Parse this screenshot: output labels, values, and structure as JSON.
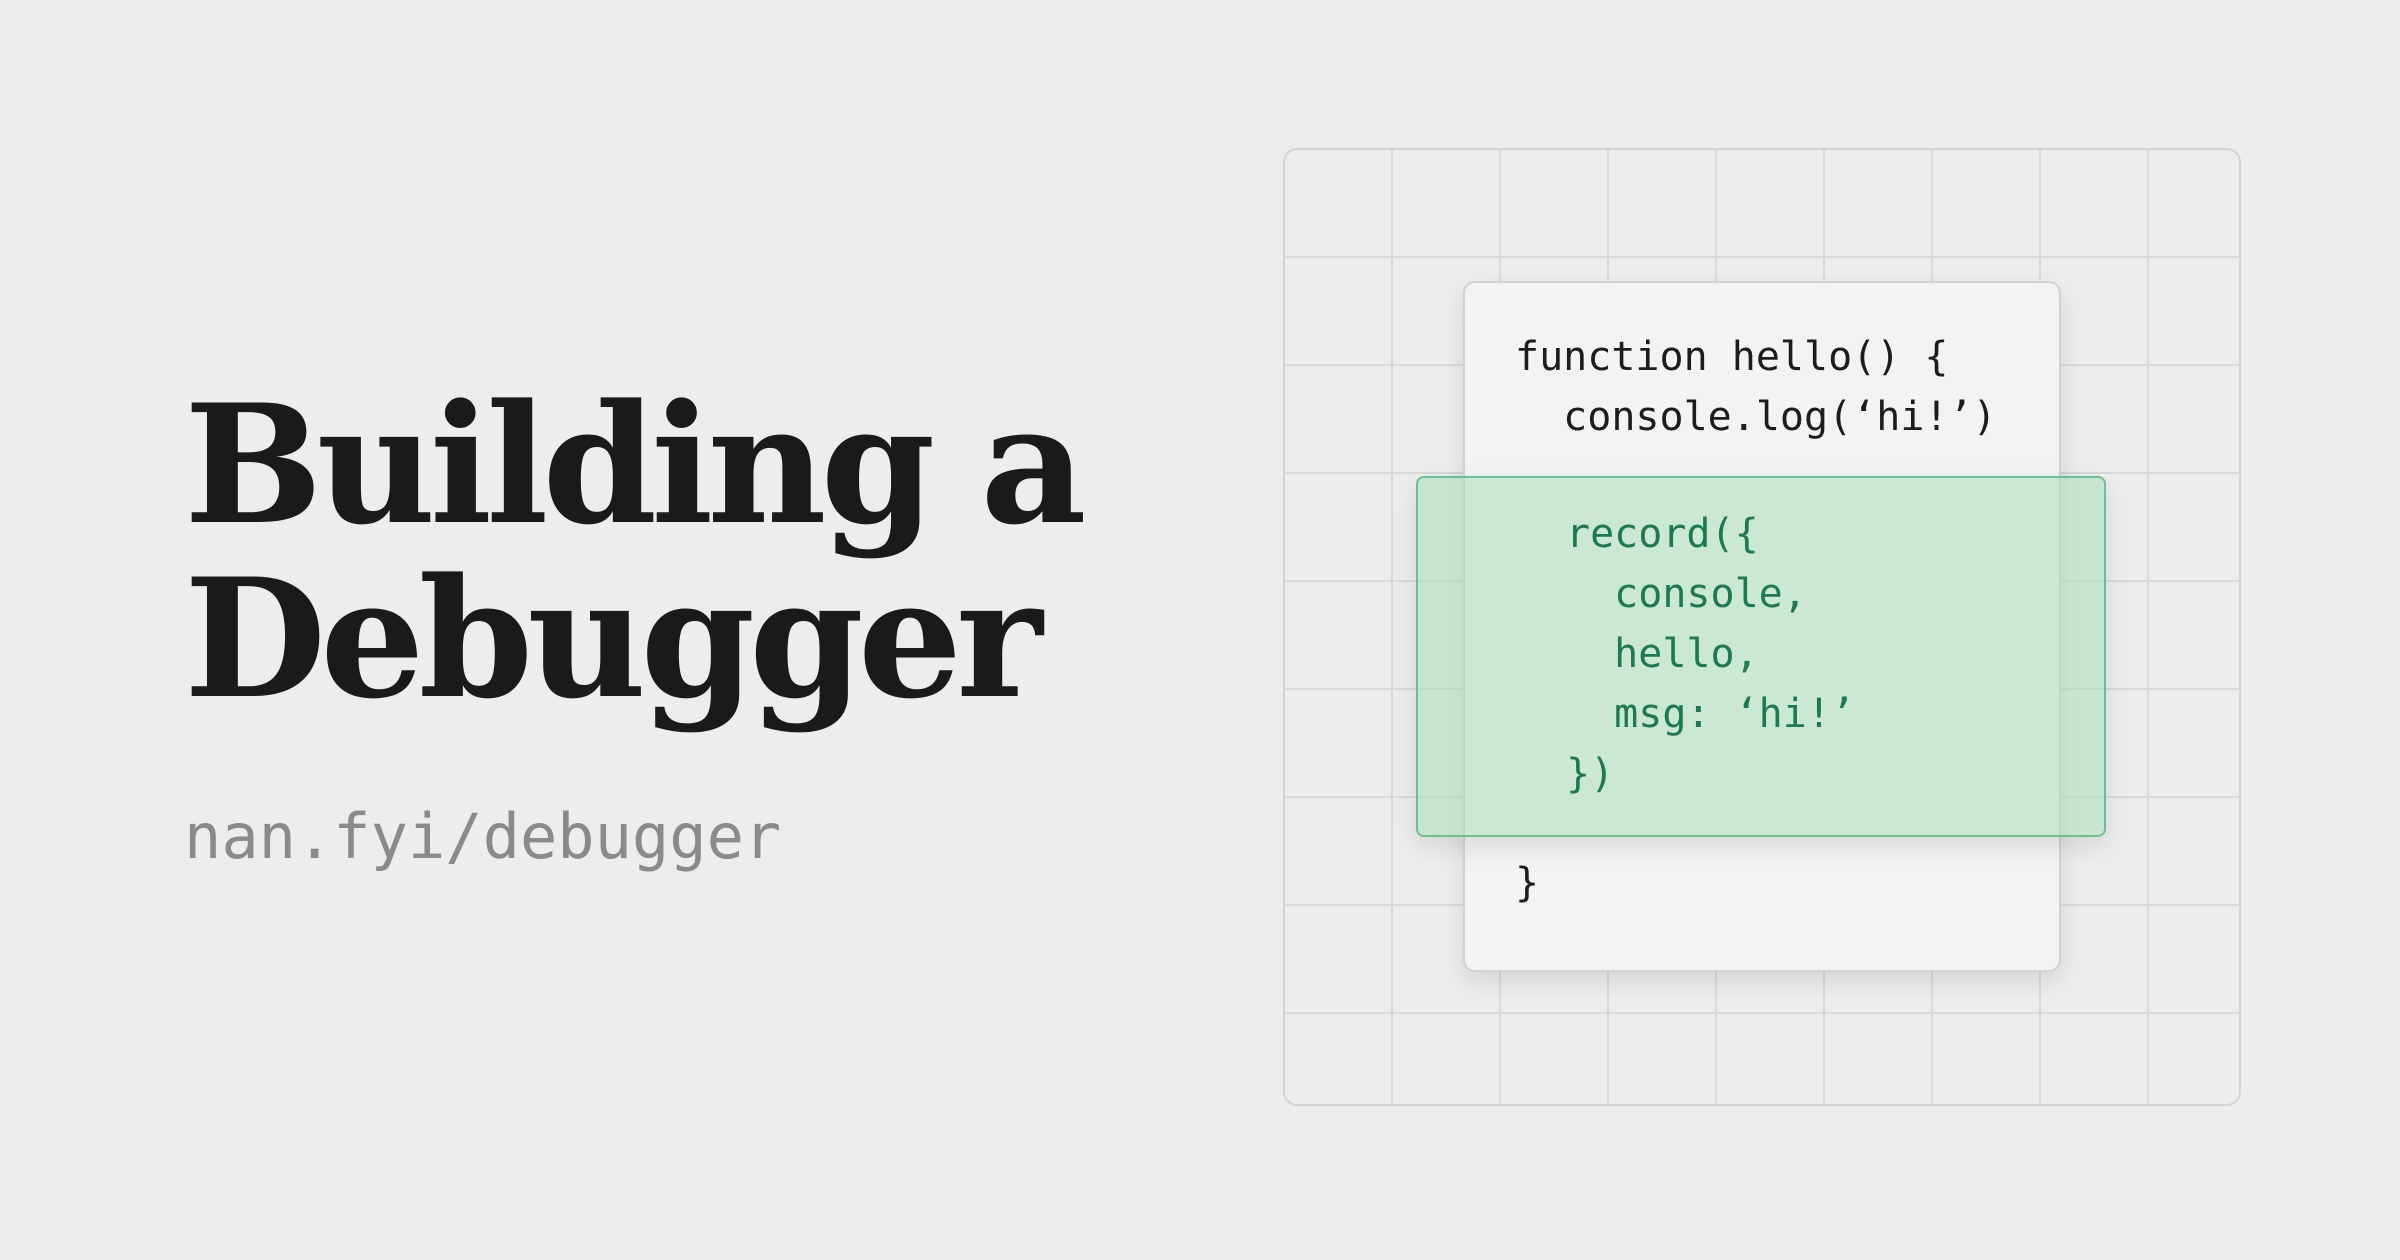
{
  "title": {
    "line1": "Building a",
    "line2": "Debugger"
  },
  "url": "nan.fyi/debugger",
  "code": {
    "top": "function hello() {\n  console.log(‘hi!’)",
    "highlighted": "record({\n  console,\n  hello,\n  msg: ‘hi!’\n})",
    "bottom": "}"
  },
  "colors": {
    "background": "#ededed",
    "title": "#1a1a1a",
    "url": "#8a8a8a",
    "highlight_fill": "#c5e4d2",
    "highlight_border": "#6cbf8e",
    "highlight_text": "#1d7a4c"
  }
}
